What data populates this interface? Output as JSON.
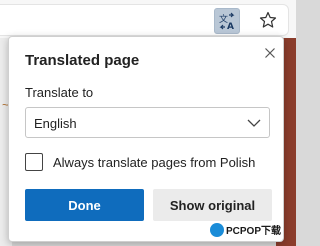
{
  "browser": {
    "translate_icon": "translate-icon",
    "favorite_icon": "star-outline-icon"
  },
  "panel": {
    "title": "Translated page",
    "close_icon": "close-icon",
    "translate_to_label": "Translate to",
    "language_select": {
      "value": "English"
    },
    "checkbox": {
      "label": "Always translate pages from Polish",
      "checked": false
    },
    "buttons": {
      "done": "Done",
      "show_original": "Show original"
    }
  },
  "watermark": {
    "text": "PCPOP下载"
  },
  "colors": {
    "primary": "#0f6cbd",
    "secondary": "#ebebeb",
    "translate_active_bg": "#b9c7d6",
    "page_background": "#8b3d2c"
  }
}
